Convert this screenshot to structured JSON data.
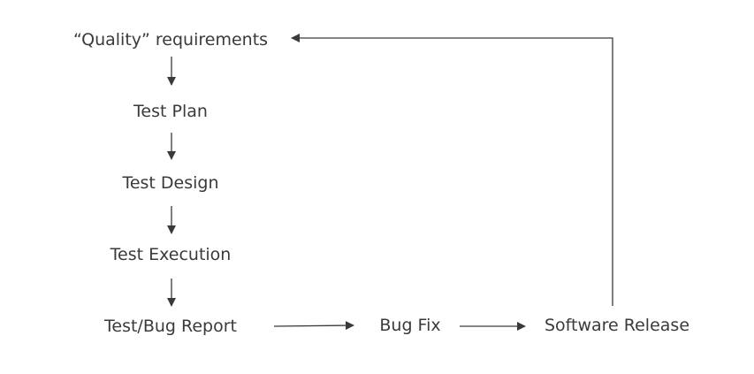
{
  "diagram": {
    "nodes": {
      "quality": "“Quality” requirements",
      "plan": "Test Plan",
      "design": "Test Design",
      "execution": "Test Execution",
      "report": "Test/Bug Report",
      "fix": "Bug Fix",
      "release": "Software Release"
    },
    "line_color": "#3a3a3a"
  }
}
